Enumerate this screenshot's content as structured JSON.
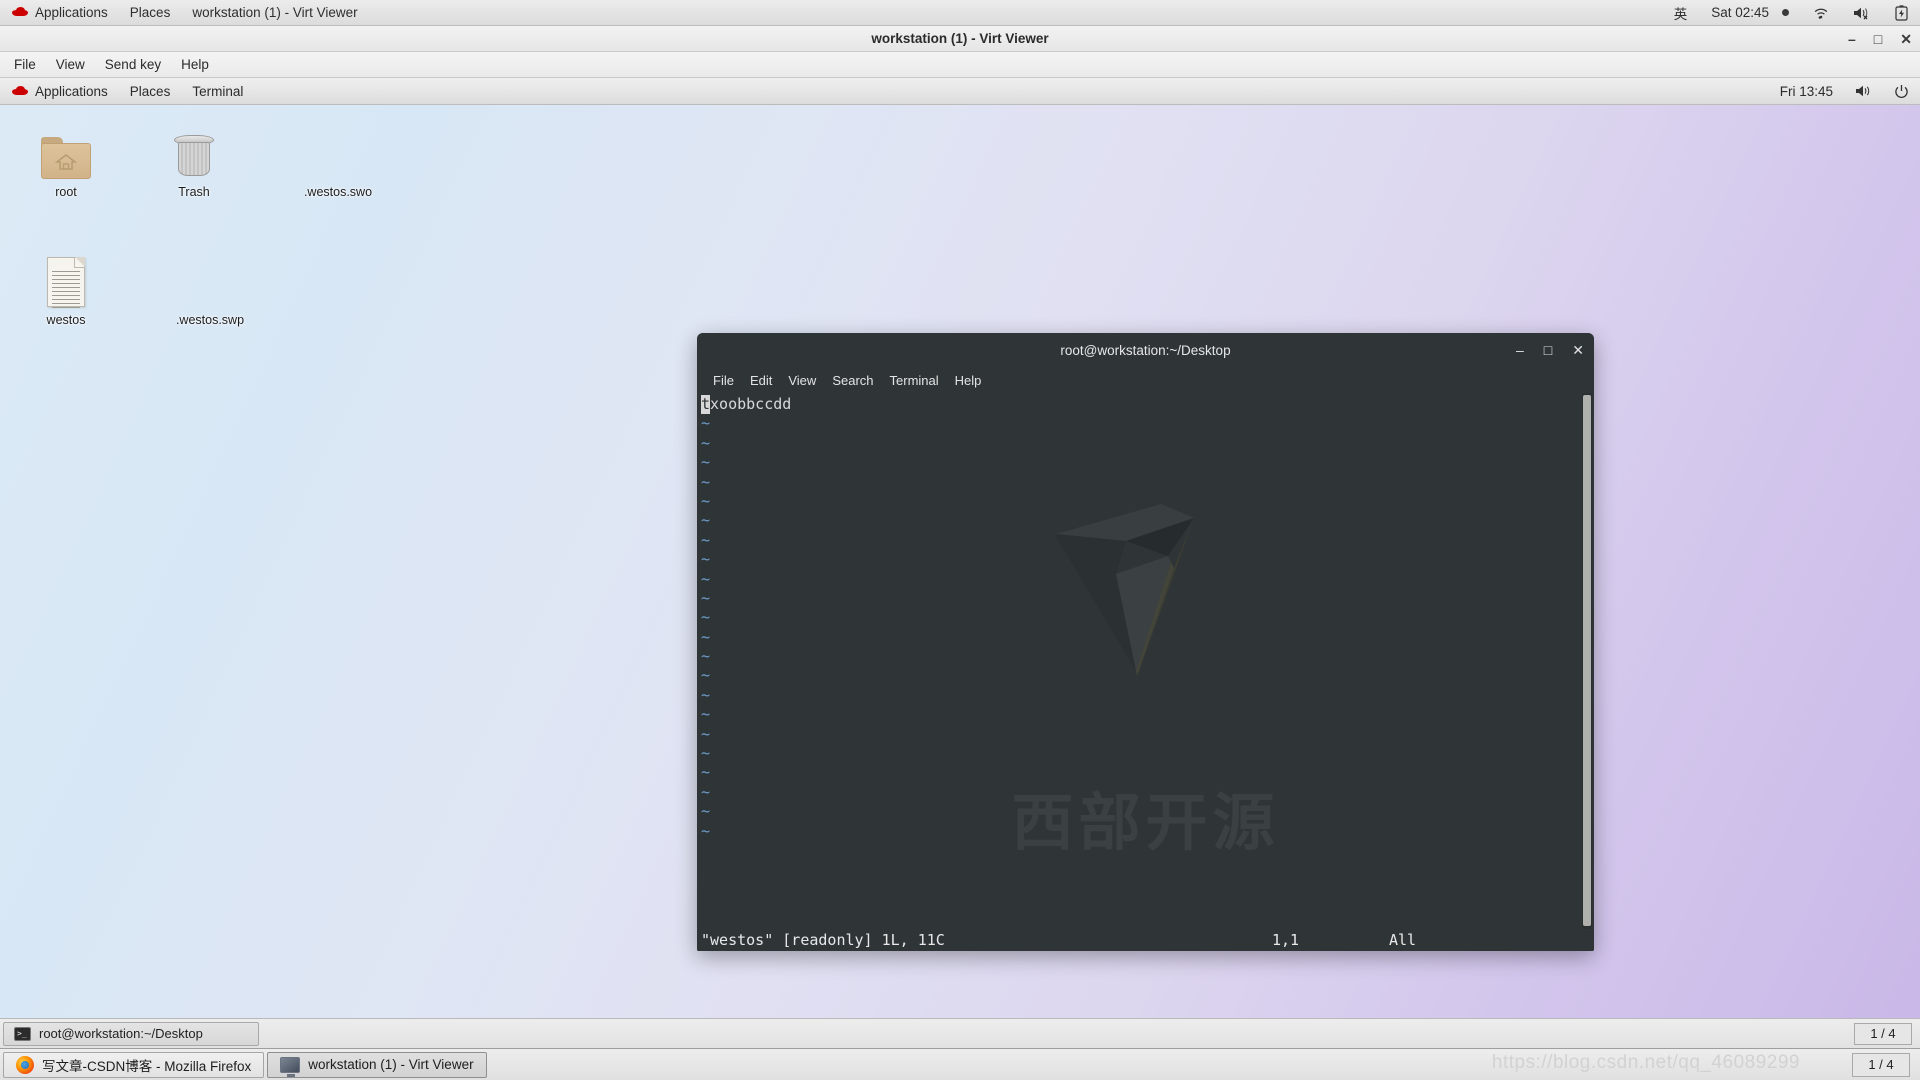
{
  "host_panel": {
    "applications": "Applications",
    "places": "Places",
    "window_title": "workstation (1) - Virt Viewer",
    "input_method": "英",
    "clock": "Sat 02:45",
    "icons": [
      "wifi-icon",
      "volume-muted-icon",
      "battery-charging-icon"
    ]
  },
  "virt_viewer": {
    "title": "workstation (1) - Virt Viewer",
    "menu": [
      "File",
      "View",
      "Send key",
      "Help"
    ],
    "window_controls": {
      "minimize": "–",
      "maximize": "□",
      "close": "✕"
    }
  },
  "guest_panel": {
    "applications": "Applications",
    "places": "Places",
    "terminal": "Terminal",
    "clock": "Fri 13:45",
    "icons": [
      "volume-icon",
      "power-icon"
    ]
  },
  "desktop": {
    "icons": [
      {
        "label": "root",
        "type": "folder"
      },
      {
        "label": "Trash",
        "type": "trash"
      },
      {
        "label": ".westos.swo",
        "type": "none"
      },
      {
        "label": "westos",
        "type": "document"
      },
      {
        "label": ".westos.swp",
        "type": "none"
      }
    ]
  },
  "terminal": {
    "title": "root@workstation:~/Desktop",
    "menu": [
      "File",
      "Edit",
      "View",
      "Search",
      "Terminal",
      "Help"
    ],
    "window_controls": {
      "minimize": "–",
      "maximize": "□",
      "close": "✕"
    },
    "content": {
      "cursor_char": "t",
      "first_line_rest": "xoobbccdd",
      "tilde": "~",
      "tilde_count": 22
    },
    "status": {
      "file": "\"westos\" [readonly] 1L, 11C",
      "position": "1,1",
      "scroll": "All"
    },
    "watermark_text": "西部开源"
  },
  "taskbar": {
    "upper_window": "root@workstation:~/Desktop",
    "upper_pager": "1 / 4",
    "firefox_window": "写文章-CSDN博客 - Mozilla Firefox",
    "virtviewer_window": "workstation (1) - Virt Viewer",
    "lower_pager": "1 / 4"
  },
  "watermark_url": "https://blog.csdn.net/qq_46089299",
  "colors": {
    "terminal_bg": "#2f3537",
    "tilde_blue": "#6f9fd0",
    "accent_red": "#cc0000"
  }
}
